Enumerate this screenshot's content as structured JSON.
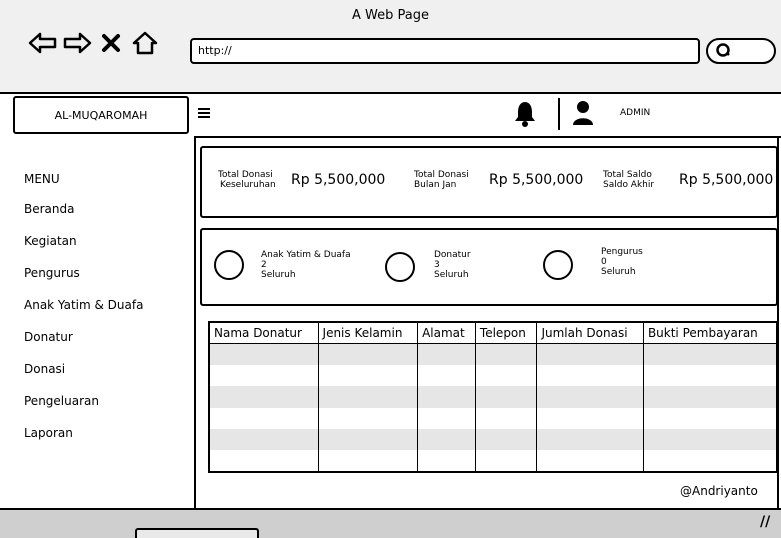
{
  "window": {
    "title": "A Web Page"
  },
  "browser": {
    "url": "http://",
    "nav_icons": [
      "back-arrow-icon",
      "forward-arrow-icon",
      "close-icon",
      "home-icon"
    ]
  },
  "sidebar": {
    "brand": "AL-MUQAROMAH",
    "menu_heading": "MENU",
    "items": [
      "Beranda",
      "Kegiatan",
      "Pengurus",
      "Anak Yatim & Duafa",
      "Donatur",
      "Donasi",
      "Pengeluaran",
      "Laporan"
    ]
  },
  "header": {
    "user_label": "ADMIN"
  },
  "summary": [
    {
      "label_line1": "Total Donasi",
      "label_line2": "Keseluruhan",
      "value": "Rp 5,500,000"
    },
    {
      "label_line1": "Total Donasi",
      "label_line2": "Bulan Jan",
      "value": "Rp 5,500,000"
    },
    {
      "label_line1": "Total Saldo",
      "label_line2": "Saldo Akhir",
      "value": "Rp 5,500,000"
    }
  ],
  "counts": [
    {
      "title": "Anak Yatim & Duafa",
      "count": "2",
      "caption": "Seluruh"
    },
    {
      "title": "Donatur",
      "count": "3",
      "caption": "Seluruh"
    },
    {
      "title": "Pengurus",
      "count": "0",
      "caption": "Seluruh"
    }
  ],
  "table": {
    "columns": [
      "Nama Donatur",
      "Jenis Kelamin",
      "Alamat",
      "Telepon",
      "Jumlah Donasi",
      "Bukti Pembayaran"
    ]
  },
  "footer": {
    "credit": "@Andriyanto"
  }
}
